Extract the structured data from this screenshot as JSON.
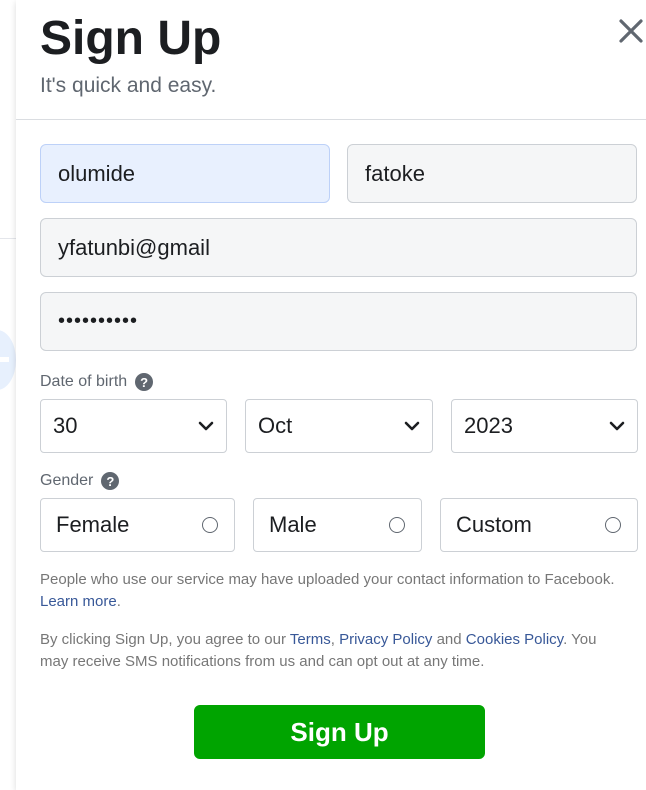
{
  "header": {
    "title": "Sign Up",
    "subtitle": "It's quick and easy."
  },
  "form": {
    "first_name": "olumide",
    "surname": "fatoke",
    "email": "yfatunbi@gmail",
    "password_masked": "••••••••••",
    "dob": {
      "label": "Date of birth",
      "day": "30",
      "month": "Oct",
      "year": "2023"
    },
    "gender": {
      "label": "Gender",
      "options": [
        "Female",
        "Male",
        "Custom"
      ]
    }
  },
  "info": {
    "contact_text": "People who use our service may have uploaded your contact information to Facebook.",
    "learn_more": "Learn more",
    "terms_prefix": "By clicking Sign Up, you agree to our",
    "terms": "Terms",
    "privacy": "Privacy Policy",
    "and": "and",
    "cookies": "Cookies Policy",
    "sms_text": "You may receive SMS notifications from us and can opt out at any time."
  },
  "actions": {
    "signup_label": "Sign Up"
  },
  "colors": {
    "primary_green": "#00a400",
    "link_blue": "#385898",
    "autofill_blue": "#e8f0fe"
  },
  "icons": {
    "close": "close-icon",
    "help": "question-circle-icon",
    "chevron": "chevron-down-icon",
    "radio": "radio-unchecked-icon"
  }
}
